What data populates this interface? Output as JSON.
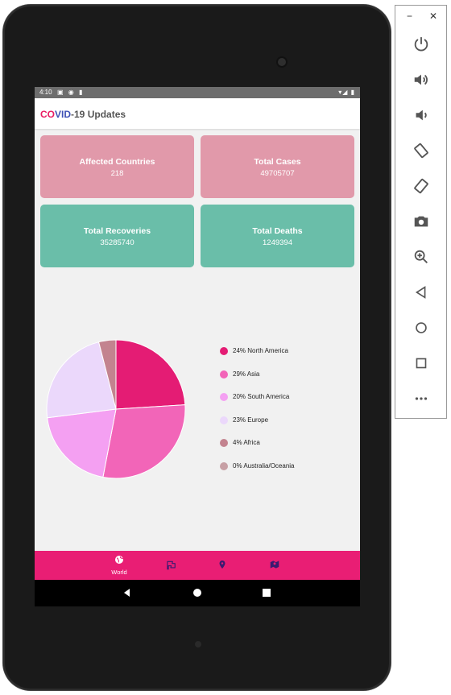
{
  "statusbar": {
    "time": "4:10"
  },
  "app": {
    "title_co": "CO",
    "title_vid": "VID",
    "title_rest": "-19 Updates"
  },
  "stats": [
    {
      "label": "Affected Countries",
      "value": "218"
    },
    {
      "label": "Total Cases",
      "value": "49705707"
    },
    {
      "label": "Total Recoveries",
      "value": "35285740"
    },
    {
      "label": "Total Deaths",
      "value": "1249394"
    }
  ],
  "chart_data": {
    "type": "pie",
    "title": "",
    "slices": [
      {
        "label": "24% North America",
        "value": 24,
        "color": "#e41c74"
      },
      {
        "label": "29% Asia",
        "value": 29,
        "color": "#f265b8"
      },
      {
        "label": "20% South America",
        "value": 20,
        "color": "#f4a0f2"
      },
      {
        "label": "23% Europe",
        "value": 23,
        "color": "#ebd8fb"
      },
      {
        "label": "4% Africa",
        "value": 4,
        "color": "#c3838f"
      },
      {
        "label": "0% Australia/Oceania",
        "value": 0,
        "color": "#c7a0a5"
      }
    ],
    "legend": "right"
  },
  "bottomnav": {
    "world_label": "World"
  },
  "colors": {
    "accent": "#e91e74",
    "card_pink": "#e199aa",
    "card_teal": "#6abea9"
  }
}
